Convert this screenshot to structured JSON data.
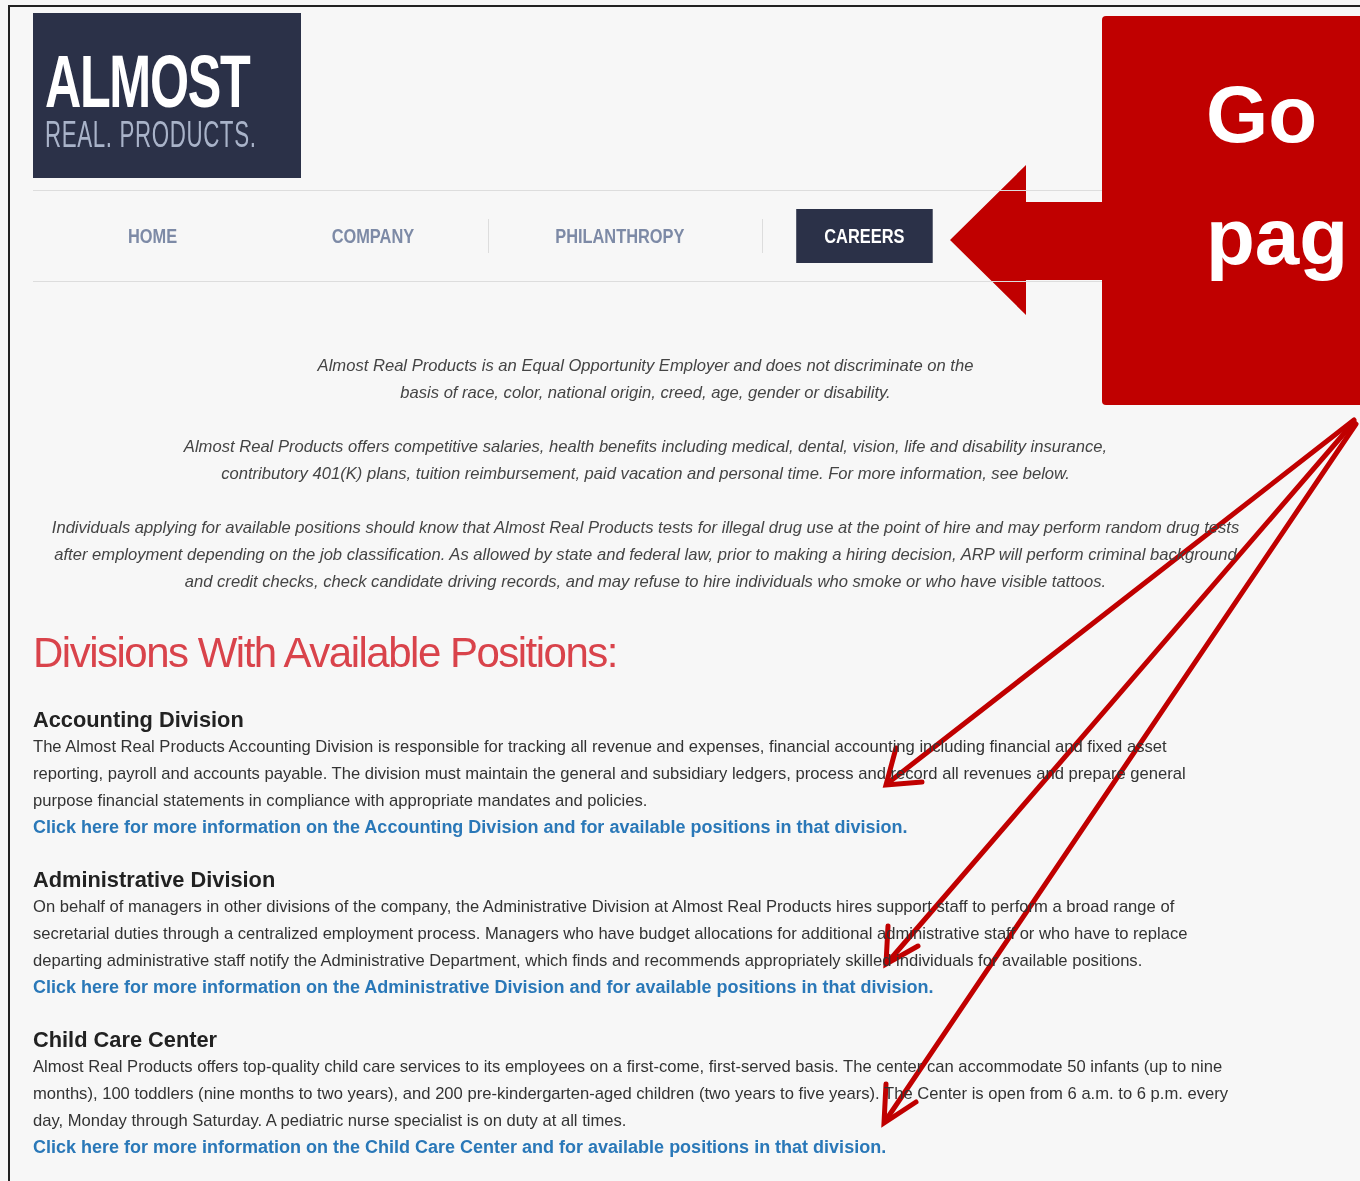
{
  "logo": {
    "title": "ALMOST",
    "subtitle": "REAL. PRODUCTS."
  },
  "nav": [
    {
      "label": "HOME",
      "selected": false
    },
    {
      "label": "COMPANY",
      "selected": false
    },
    {
      "label": "PHILANTHROPY",
      "selected": false
    },
    {
      "label": "CAREERS",
      "selected": true
    }
  ],
  "intro": [
    "Almost Real Products is an Equal Opportunity Employer and does not discriminate on the basis of race, color, national origin, creed, age, gender or disability.",
    "Almost Real Products offers competitive salaries, health benefits including medical, dental, vision, life and disability insurance, contributory 401(K) plans, tuition reimbursement, paid vacation and personal time. For more information, see below.",
    "Individuals applying for available positions should know that Almost Real Products tests for illegal drug use at the point of hire and may perform random drug tests after employment depending on the job classification. As allowed by state and federal law, prior to making a hiring decision, ARP will perform criminal background and credit checks, check candidate driving records, and may refuse to hire individuals who smoke or who have visible tattoos."
  ],
  "heading": "Divisions With Available Positions:",
  "divisions": [
    {
      "title": "Accounting Division",
      "description": "The Almost Real Products Accounting Division is responsible for tracking all revenue and expenses, financial accounting including financial and fixed asset reporting, payroll and accounts payable. The division must maintain the general and subsidiary ledgers, process and record all revenues and prepare general purpose financial statements in compliance with appropriate mandates and policies.",
      "link": "Click here for more information on the Accounting Division and for available positions in that division."
    },
    {
      "title": "Administrative Division",
      "description": "On behalf of managers in other divisions of the company, the Administrative Division at Almost Real Products hires support staff to perform a broad range of secretarial duties through a centralized employment process. Managers who have budget allocations for additional administrative staff or who have to replace departing administrative staff notify the Administrative Department, which finds and recommends appropriately skilled individuals for available positions.",
      "link": "Click here for more information on the Administrative Division and for available positions in that division."
    },
    {
      "title": "Child Care Center",
      "description": "Almost Real Products offers top-quality child care services to its employees on a first-come, first-served basis. The center can accommodate 50 infants (up to nine months), 100 toddlers (nine months to two years), and 200 pre-kindergarten-aged children (two years to five years). The Center is open from 6 a.m. to 6 p.m. every day, Monday through Saturday. A pediatric nurse specialist is on duty at all times.",
      "link": "Click here for more information on the Child Care Center and for available positions in that division."
    }
  ],
  "callout": {
    "lines": [
      "Go",
      "pag"
    ]
  }
}
